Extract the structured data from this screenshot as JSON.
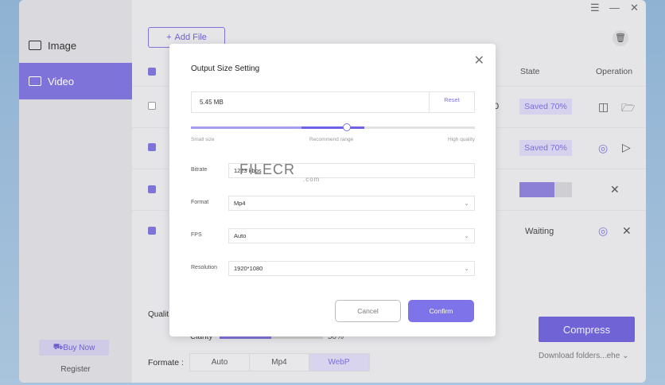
{
  "sidebar": {
    "items": [
      {
        "label": "Image",
        "icon": "image-icon"
      },
      {
        "label": "Video",
        "icon": "video-icon",
        "active": true
      }
    ],
    "buy_now": "Buy Now",
    "register": "Register"
  },
  "toolbar": {
    "add_file": "Add File"
  },
  "table": {
    "headers": {
      "state": "State",
      "operation": "Operation"
    },
    "rows": [
      {
        "checked": false,
        "state": "Saved 70%",
        "extra": "0"
      },
      {
        "checked": true,
        "state": "Saved 70%"
      },
      {
        "checked": true,
        "progress": 0.67
      },
      {
        "checked": true,
        "state": "Waiting"
      }
    ]
  },
  "bottom": {
    "quality_label": "Qualit",
    "clarity_label": "Clarity",
    "clarity_value": "50%",
    "clarity_fraction": 0.5,
    "format_label": "Formate :",
    "formats": [
      "Auto",
      "Mp4",
      "WebP"
    ],
    "selected_format": "WebP",
    "compress": "Compress",
    "download": "Download folders...ehe"
  },
  "modal": {
    "title": "Output Size Setting",
    "size": "5.45 MB",
    "reset": "Reset",
    "slider_value": 0.55,
    "range": [
      0.39,
      0.61
    ],
    "labels": {
      "small": "Small size",
      "recommend": "Recommend range",
      "high": "High quality"
    },
    "fields": {
      "bitrate_label": "Bitrate",
      "bitrate": "1223 kbps",
      "format_label": "Format",
      "format": "Mp4",
      "fps_label": "FPS",
      "fps": "Auto",
      "resolution_label": "Resolution",
      "resolution": "1920*1080"
    },
    "cancel": "Cancel",
    "confirm": "Confirm"
  },
  "watermark": {
    "text": "FILECR",
    "sub": ".com"
  }
}
